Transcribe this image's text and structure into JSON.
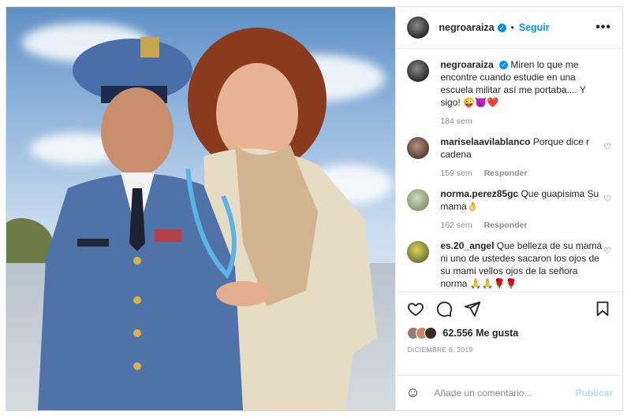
{
  "header": {
    "username": "negroaraiza",
    "follow_label": "Seguir",
    "more_label": "•••"
  },
  "caption": {
    "username": "negroaraiza",
    "text": "Miren lo que me encontre cuando estudie en una escuela militar así me portaba.... Y sigo! 😜😈❤️",
    "time": "184 sem"
  },
  "comments": [
    {
      "username": "mariselaavilablanco",
      "text": "Porque dice r cadena",
      "time": "159 sem",
      "reply_label": "Responder"
    },
    {
      "username": "norma.perez85gc",
      "text": "Que guapisima Su mama👌",
      "time": "162 sem",
      "reply_label": "Responder"
    },
    {
      "username": "es.20_angel",
      "text": "Que belleza de su mamá ni uno de ustedes sacaron los ojos de su mami vellos ojos de la señora norma 🙏🙏🌹🌹",
      "time": "",
      "reply_label": ""
    }
  ],
  "likes": {
    "count_text": "62.556 Me gusta"
  },
  "date": "DICIEMBRE 6, 2019",
  "comment_box": {
    "placeholder": "Añade un comentario...",
    "publish_label": "Publicar"
  },
  "icons": [
    "heart-icon",
    "comment-icon",
    "share-icon",
    "bookmark-icon",
    "emoji-icon",
    "verified-icon",
    "more-icon"
  ]
}
